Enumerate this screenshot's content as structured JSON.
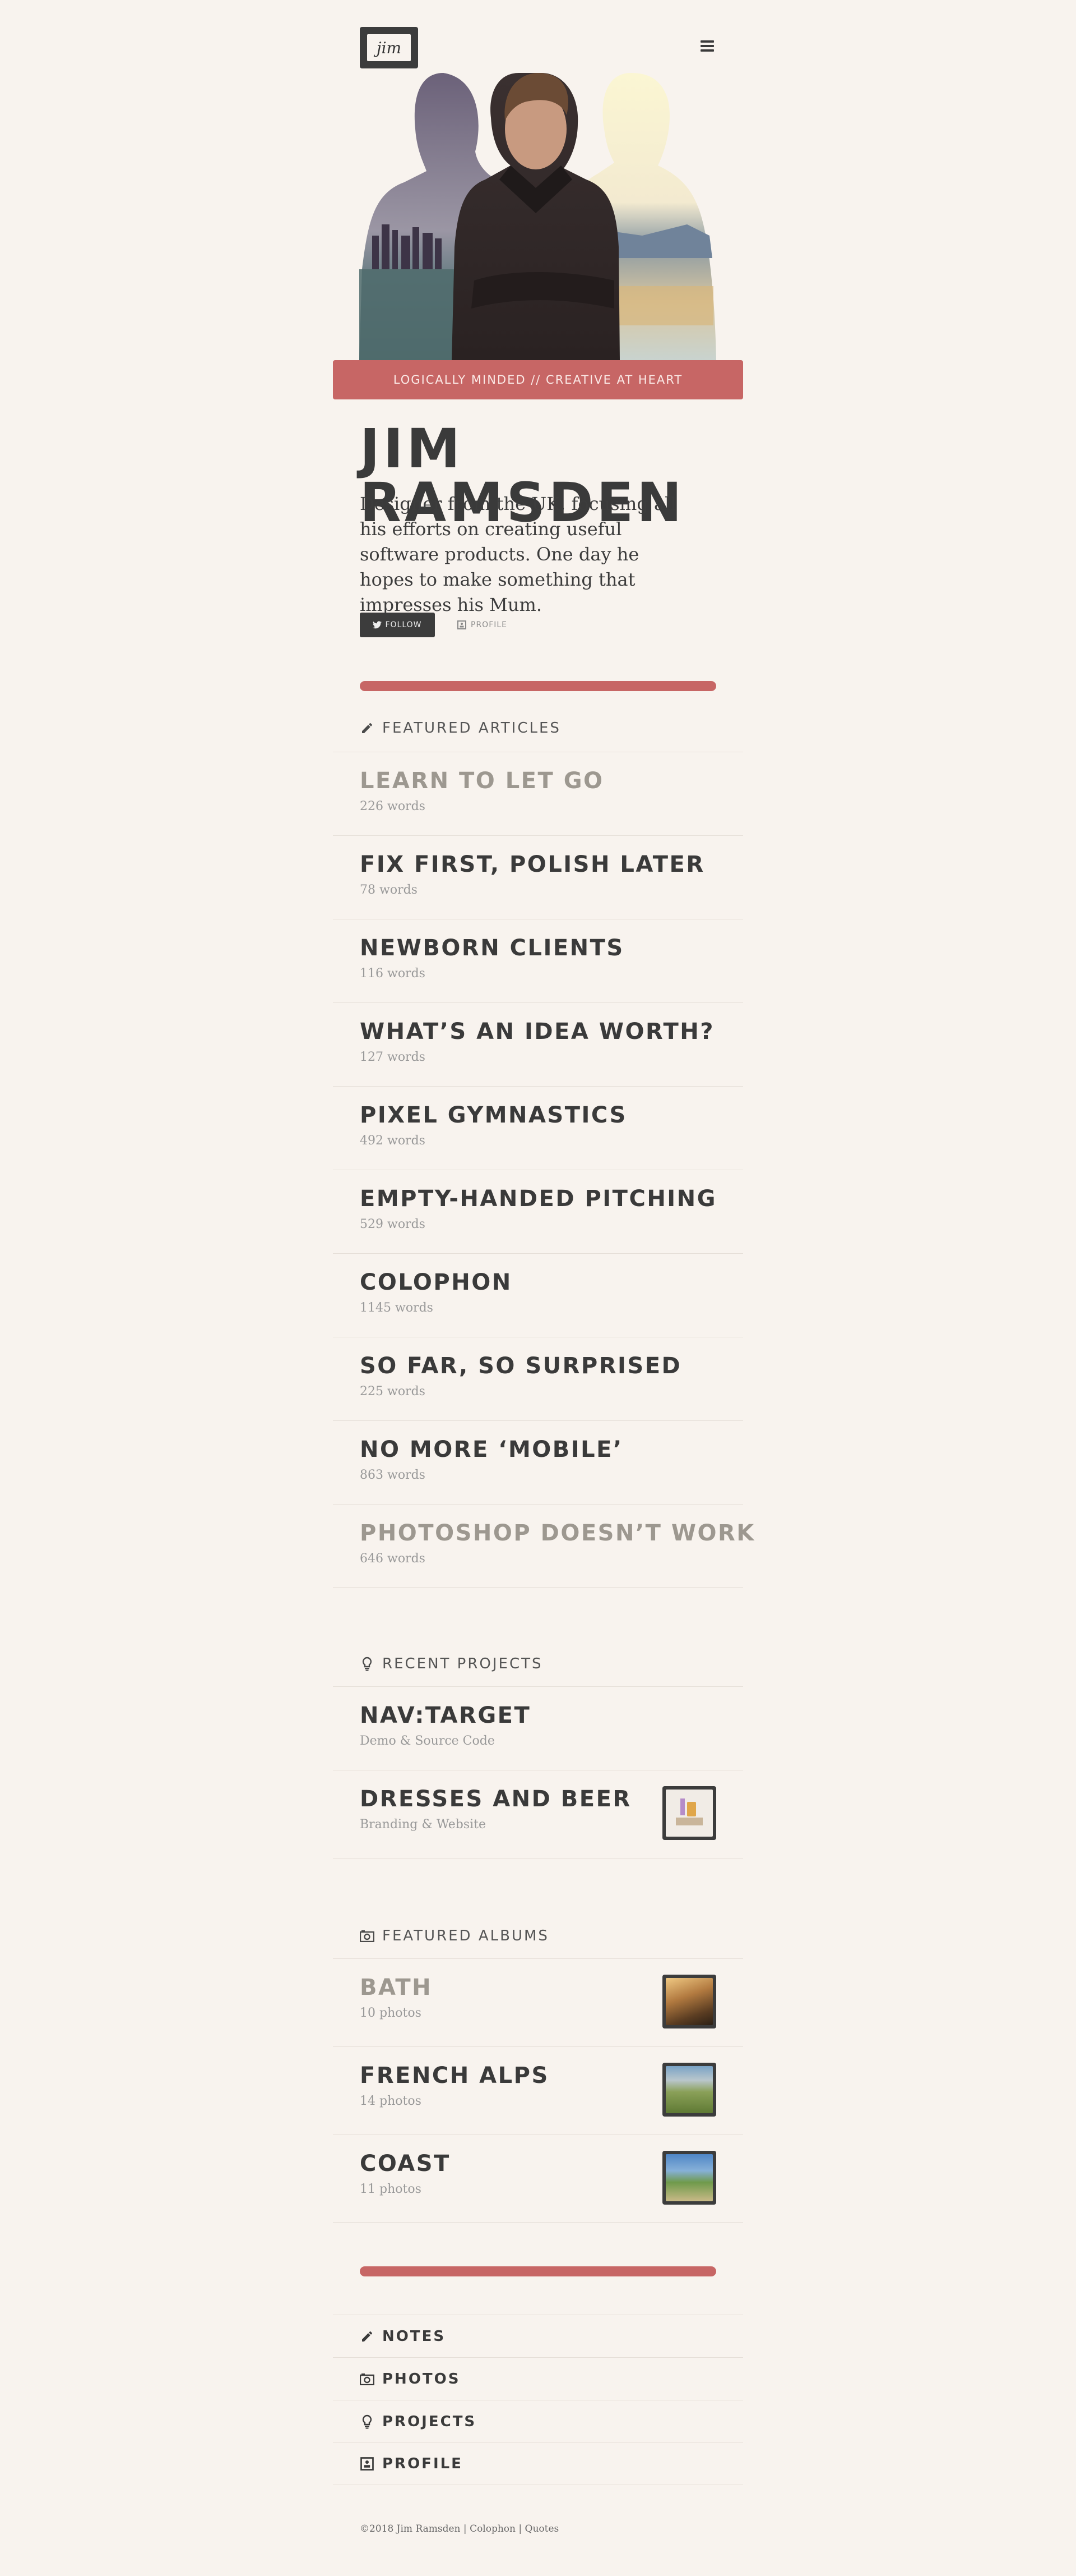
{
  "header": {
    "logo_text": "jim",
    "menu_icon": "hamburger-menu-icon"
  },
  "hero": {
    "tagline": "LOGICALLY MINDED // CREATIVE AT HEART"
  },
  "intro": {
    "name": "JIM RAMSDEN",
    "bio": "Designer from the UK, focusing all his efforts on creating useful software products. One day he hopes to make something that impresses his Mum.",
    "follow_label": "FOLLOW",
    "profile_label": "PROFILE"
  },
  "articles": {
    "heading": "FEATURED ARTICLES",
    "icon": "pencil-icon",
    "items": [
      {
        "title": "LEARN TO LET GO",
        "meta": "226 words"
      },
      {
        "title": "FIX FIRST, POLISH LATER",
        "meta": "78 words"
      },
      {
        "title": "NEWBORN CLIENTS",
        "meta": "116 words"
      },
      {
        "title": "WHAT’S AN IDEA WORTH?",
        "meta": "127 words"
      },
      {
        "title": "PIXEL GYMNASTICS",
        "meta": "492 words"
      },
      {
        "title": "EMPTY-HANDED PITCHING",
        "meta": "529 words"
      },
      {
        "title": "COLOPHON",
        "meta": "1145 words"
      },
      {
        "title": "SO FAR, SO SURPRISED",
        "meta": "225 words"
      },
      {
        "title": "NO MORE ‘MOBILE’",
        "meta": "863 words"
      },
      {
        "title": "PHOTOSHOP DOESN’T WORK",
        "meta": "646 words"
      }
    ]
  },
  "projects": {
    "heading": "RECENT PROJECTS",
    "icon": "lightbulb-icon",
    "items": [
      {
        "title": "NAV:TARGET",
        "meta": "Demo & Source Code"
      },
      {
        "title": "DRESSES AND BEER",
        "meta": "Branding & Website"
      }
    ]
  },
  "albums": {
    "heading": "FEATURED ALBUMS",
    "icon": "camera-icon",
    "items": [
      {
        "title": "BATH",
        "meta": "10 photos"
      },
      {
        "title": "FRENCH ALPS",
        "meta": "14 photos"
      },
      {
        "title": "COAST",
        "meta": "11 photos"
      }
    ]
  },
  "nav": {
    "items": [
      {
        "label": "NOTES",
        "icon": "pencil-icon"
      },
      {
        "label": "PHOTOS",
        "icon": "camera-icon"
      },
      {
        "label": "PROJECTS",
        "icon": "lightbulb-icon"
      },
      {
        "label": "PROFILE",
        "icon": "profile-card-icon"
      }
    ]
  },
  "footer": {
    "copyright": "©2018 Jim Ramsden",
    "sep": "|",
    "colophon": "Colophon",
    "quotes": "Quotes"
  },
  "colors": {
    "accent": "#c76665",
    "dark": "#3c3c3c",
    "background": "#f8f3ee"
  }
}
